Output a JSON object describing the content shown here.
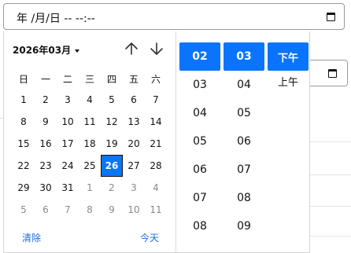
{
  "input": {
    "value": "年 /月/日 -- --:--"
  },
  "calendar": {
    "month_label": "2026年03月",
    "weekdays": [
      "日",
      "一",
      "二",
      "三",
      "四",
      "五",
      "六"
    ],
    "days": [
      "1",
      "2",
      "3",
      "4",
      "5",
      "6",
      "7",
      "8",
      "9",
      "10",
      "11",
      "12",
      "13",
      "14",
      "15",
      "16",
      "17",
      "18",
      "19",
      "20",
      "21",
      "22",
      "23",
      "24",
      "25",
      "26",
      "27",
      "28",
      "29",
      "30",
      "31",
      "1",
      "2",
      "3",
      "4",
      "5",
      "6",
      "7",
      "8",
      "9",
      "10",
      "11"
    ],
    "selected_day": "26",
    "clear_label": "清除",
    "today_label": "今天"
  },
  "time": {
    "hours": [
      "02",
      "03",
      "04",
      "05",
      "06",
      "07",
      "08"
    ],
    "minutes": [
      "03",
      "04",
      "05",
      "06",
      "07",
      "08",
      "09"
    ],
    "ampm": [
      "下午",
      "上午"
    ],
    "selected_hour": "02",
    "selected_minute": "03",
    "selected_ampm": "下午"
  },
  "colors": {
    "accent": "#0a74ff",
    "link": "#1a6fe0"
  }
}
